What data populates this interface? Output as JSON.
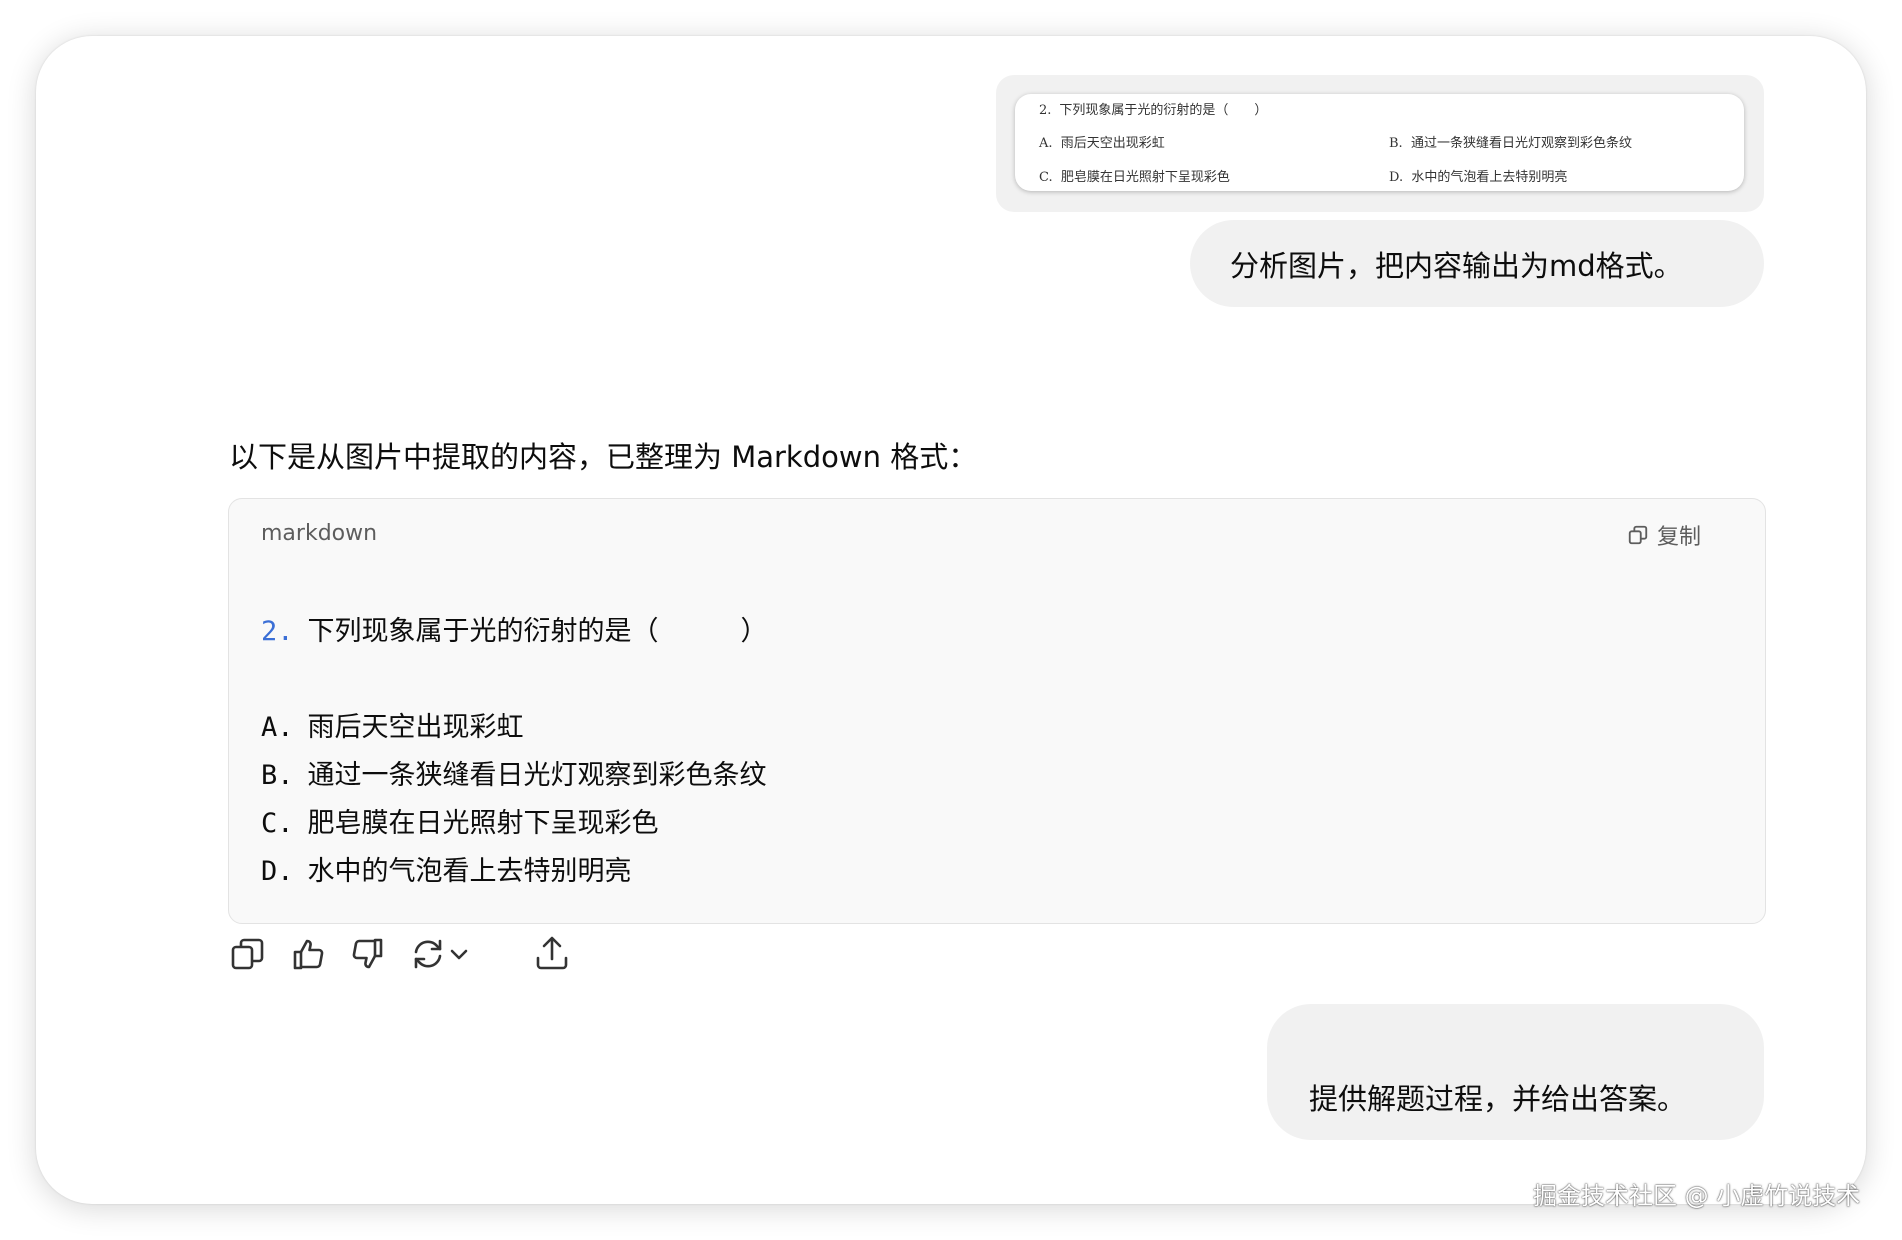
{
  "attachment": {
    "question_num": "2.",
    "question": "下列现象属于光的衍射的是（　　）",
    "options": [
      {
        "letter": "A.",
        "text": "雨后天空出现彩虹"
      },
      {
        "letter": "B.",
        "text": "通过一条狭缝看日光灯观察到彩色条纹"
      },
      {
        "letter": "C.",
        "text": "肥皂膜在日光照射下呈现彩色"
      },
      {
        "letter": "D.",
        "text": "水中的气泡看上去特别明亮"
      }
    ]
  },
  "messages": {
    "user_1": "分析图片，把内容输出为md格式。",
    "assistant_intro": "以下是从图片中提取的内容，已整理为 Markdown 格式：",
    "user_2": "提供解题过程，并给出答案。"
  },
  "code_block": {
    "language": "markdown",
    "copy_label": "复制",
    "question_num": "2.",
    "question_text": "下列现象属于光的衍射的是（",
    "question_close": "）",
    "options": [
      {
        "letter": "A.",
        "text": "雨后天空出现彩虹"
      },
      {
        "letter": "B.",
        "text": "通过一条狭缝看日光灯观察到彩色条纹"
      },
      {
        "letter": "C.",
        "text": "肥皂膜在日光照射下呈现彩色"
      },
      {
        "letter": "D.",
        "text": "水中的气泡看上去特别明亮"
      }
    ]
  },
  "actions": [
    "copy-icon",
    "thumbs-up-icon",
    "thumbs-down-icon",
    "regenerate-icon",
    "chevron-down-icon",
    "share-icon"
  ],
  "watermark": "掘金技术社区 @ 小虚竹说技术",
  "colors": {
    "list_number": "#3b6fd6",
    "bubble_bg": "#f1f1f1",
    "code_bg": "#f9f9f9"
  }
}
